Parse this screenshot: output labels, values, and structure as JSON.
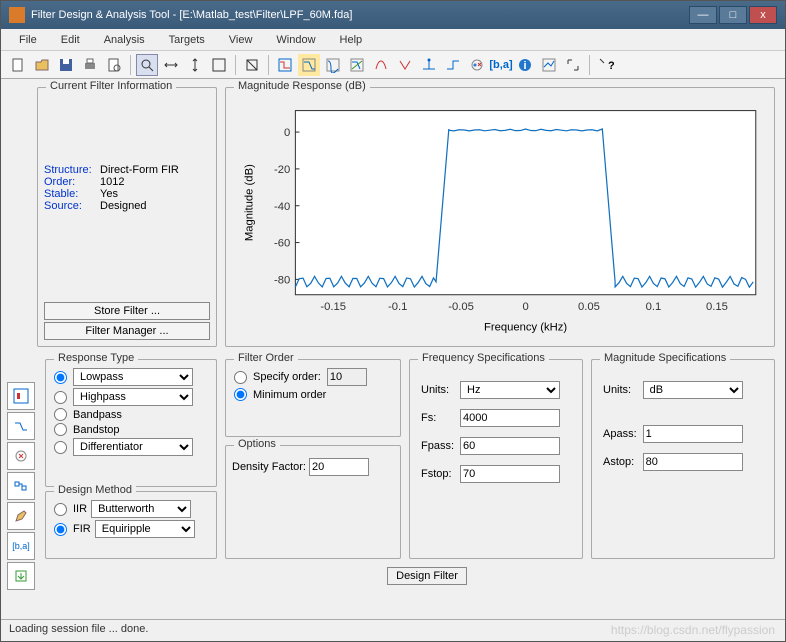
{
  "window": {
    "title": "Filter Design & Analysis Tool -  [E:\\Matlab_test\\Filter\\LPF_60M.fda]"
  },
  "menu": [
    "File",
    "Edit",
    "Analysis",
    "Targets",
    "View",
    "Window",
    "Help"
  ],
  "toolbar_icons": [
    "new",
    "open",
    "save",
    "print",
    "print-preview",
    "zoom",
    "zoom-x",
    "zoom-y",
    "zoom-full",
    "undo",
    "spec",
    "mag",
    "phase",
    "impulse",
    "step",
    "pz",
    "grpdel",
    "phasedel",
    "coeff",
    "round",
    "info",
    "filter",
    "full",
    "help"
  ],
  "info": {
    "structure_label": "Structure:",
    "structure": "Direct-Form FIR",
    "order_label": "Order:",
    "order": "1012",
    "stable_label": "Stable:",
    "stable": "Yes",
    "source_label": "Source:",
    "source": "Designed",
    "store_btn": "Store Filter ...",
    "manager_btn": "Filter Manager ..."
  },
  "groups": {
    "info": "Current Filter Information",
    "magresp": "Magnitude Response (dB)",
    "resptype": "Response Type",
    "filterorder": "Filter Order",
    "options": "Options",
    "freqspec": "Frequency Specifications",
    "magspec": "Magnitude Specifications",
    "designmethod": "Design Method"
  },
  "resptype": {
    "lowpass": "Lowpass",
    "highpass": "Highpass",
    "bandpass": "Bandpass",
    "bandstop": "Bandstop",
    "diff": "Differentiator"
  },
  "designmethod": {
    "iir": "IIR",
    "iir_sel": "Butterworth",
    "fir": "FIR",
    "fir_sel": "Equiripple"
  },
  "filterorder": {
    "specify": "Specify order:",
    "specify_val": "10",
    "minimum": "Minimum order"
  },
  "options": {
    "density_label": "Density Factor:",
    "density_val": "20"
  },
  "freq": {
    "units_label": "Units:",
    "units": "Hz",
    "fs_label": "Fs:",
    "fs": "4000",
    "fpass_label": "Fpass:",
    "fpass": "60",
    "fstop_label": "Fstop:",
    "fstop": "70"
  },
  "mag": {
    "units_label": "Units:",
    "units": "dB",
    "apass_label": "Apass:",
    "apass": "1",
    "astop_label": "Astop:",
    "astop": "80"
  },
  "design_btn": "Design Filter",
  "status": "Loading session file ... done.",
  "watermark": "https://blog.csdn.net/flypassion",
  "chart_data": {
    "type": "line",
    "title": "",
    "xlabel": "Frequency (kHz)",
    "ylabel": "Magnitude (dB)",
    "xlim": [
      -0.18,
      0.18
    ],
    "ylim": [
      -90,
      10
    ],
    "xticks": [
      -0.15,
      -0.1,
      -0.05,
      0,
      0.05,
      0.1,
      0.15
    ],
    "yticks": [
      -80,
      -60,
      -40,
      -20,
      0
    ],
    "passband_ripple_db": 1,
    "stopband_level_db": -83,
    "transition_khz": [
      0.06,
      0.07
    ],
    "x": [
      -0.18,
      -0.07,
      -0.065,
      -0.06,
      0.06,
      0.065,
      0.07,
      0.18
    ],
    "y": [
      -83,
      -83,
      -40,
      0,
      0,
      -40,
      -83,
      -83
    ]
  }
}
